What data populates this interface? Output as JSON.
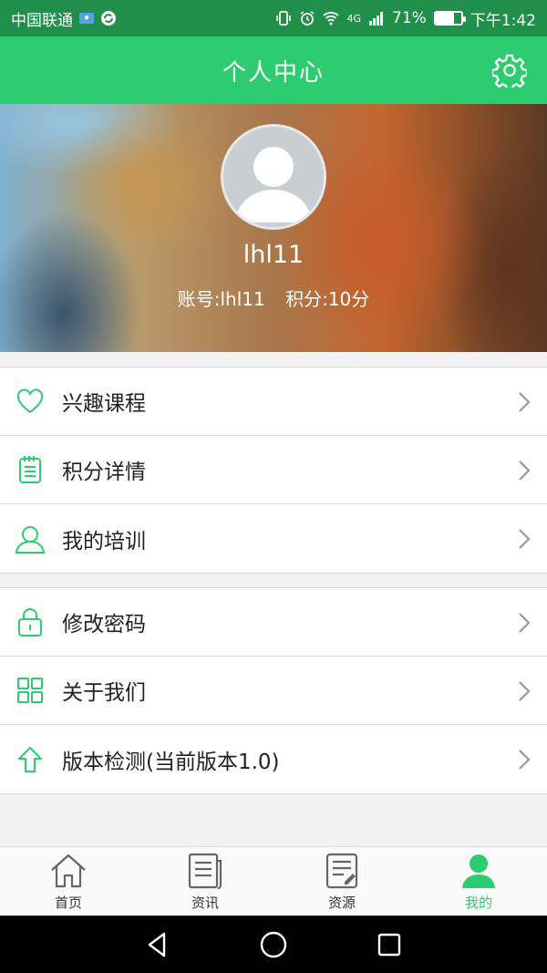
{
  "status_bar": {
    "carrier": "中国联通",
    "battery_percent": "71%",
    "network": "4G",
    "time": "下午1:42",
    "battery_level": 0.71
  },
  "header": {
    "title": "个人中心",
    "settings_icon": "gear-icon"
  },
  "profile": {
    "username": "lhl11",
    "account": "账号:lhl11",
    "points": "积分:10分"
  },
  "menu_group_1": [
    {
      "label": "兴趣课程",
      "icon": "heart-icon"
    },
    {
      "label": "积分详情",
      "icon": "notepad-icon"
    },
    {
      "label": "我的培训",
      "icon": "user-icon"
    }
  ],
  "menu_group_2": [
    {
      "label": "修改密码",
      "icon": "lock-icon"
    },
    {
      "label": "关于我们",
      "icon": "grid-icon"
    },
    {
      "label": "版本检测(当前版本1.0)",
      "icon": "upload-arrow-icon"
    }
  ],
  "bottom_nav": [
    {
      "label": "首页",
      "icon": "home-icon",
      "active": false
    },
    {
      "label": "资讯",
      "icon": "news-icon",
      "active": false
    },
    {
      "label": "资源",
      "icon": "document-icon",
      "active": false
    },
    {
      "label": "我的",
      "icon": "person-icon",
      "active": true
    }
  ],
  "colors": {
    "primary": "#2ecc71",
    "status_bar": "#1f8f4a",
    "text": "#222222",
    "divider": "#dcdcdc"
  }
}
